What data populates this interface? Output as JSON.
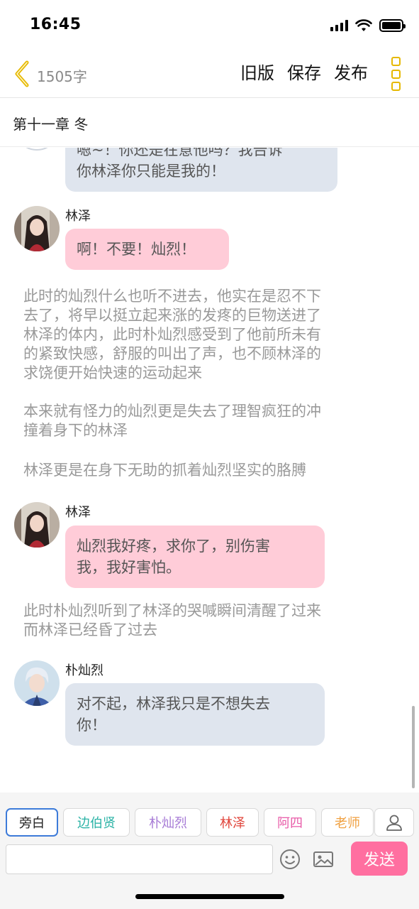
{
  "status_bar": {
    "time": "16:45"
  },
  "nav": {
    "word_count": "1505字",
    "old_version": "旧版",
    "save": "保存",
    "publish": "发布"
  },
  "chapter": {
    "title": "第十一章 冬"
  },
  "messages": [
    {
      "type": "bubble",
      "sender": "",
      "style": "blue",
      "lines": [
        "嗯~！你还是在意他吗？我告诉",
        "你林泽你只能是我的！"
      ]
    },
    {
      "type": "bubble",
      "sender": "林泽",
      "style": "pink",
      "lines": [
        "啊！不要！灿烈！"
      ]
    },
    {
      "type": "narration",
      "lines": [
        "此时的灿烈什么也听不进去，他实在是忍不下",
        "去了，将早以挺立起来涨的发疼的巨物送进了",
        "林泽的体内，此时朴灿烈感受到了他前所未有",
        "的紧致快感，舒服的叫出了声，也不顾林泽的",
        "求饶便开始快速的运动起来"
      ]
    },
    {
      "type": "narration",
      "lines": [
        "本来就有怪力的灿烈更是失去了理智疯狂的冲",
        "撞着身下的林泽"
      ]
    },
    {
      "type": "narration",
      "lines": [
        "林泽更是在身下无助的抓着灿烈坚实的胳膊"
      ]
    },
    {
      "type": "bubble",
      "sender": "林泽",
      "style": "pink",
      "lines": [
        "灿烈我好疼，求你了，别伤害",
        "我，我好害怕。"
      ]
    },
    {
      "type": "narration",
      "lines": [
        "此时朴灿烈听到了林泽的哭喊瞬间清醒了过来",
        "而林泽已经昏了过去"
      ]
    },
    {
      "type": "bubble",
      "sender": "朴灿烈",
      "style": "blue",
      "lines": [
        "对不起，林泽我只是不想失去",
        "你！"
      ]
    }
  ],
  "roles": [
    {
      "label": "旁白",
      "color": "#222222"
    },
    {
      "label": "边伯贤",
      "color": "#2bb3a6"
    },
    {
      "label": "朴灿烈",
      "color": "#a77bd6"
    },
    {
      "label": "林泽",
      "color": "#e0443a"
    },
    {
      "label": "阿四",
      "color": "#e85aa8"
    },
    {
      "label": "老师",
      "color": "#f0a040"
    }
  ],
  "composer": {
    "input_value": "",
    "send_label": "发送"
  },
  "colors": {
    "accent_yellow": "#e6b800",
    "send_pink": "#ff6fa0",
    "bubble_blue": "#dfe5ee",
    "bubble_pink": "#ffccd8"
  }
}
